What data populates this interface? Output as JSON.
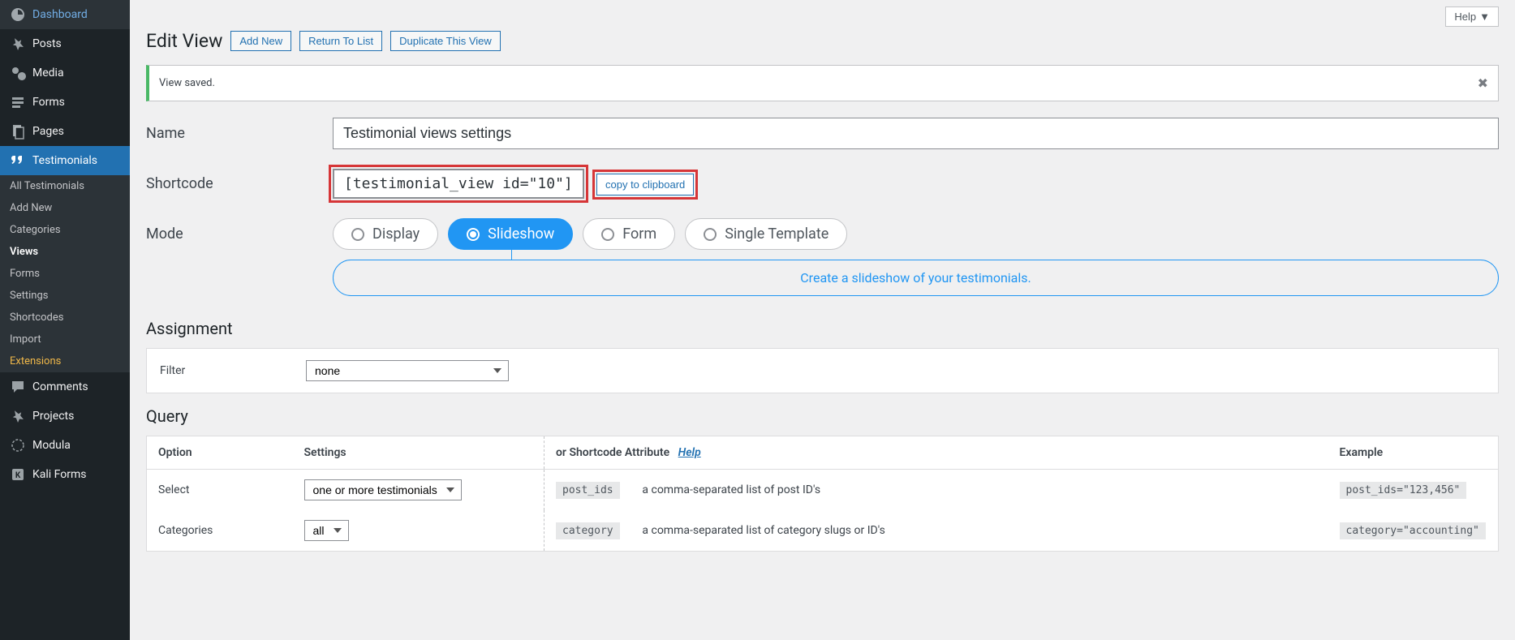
{
  "topbar": {
    "help": "Help"
  },
  "sidebar": {
    "items": [
      {
        "label": "Dashboard",
        "icon": "dashboard"
      },
      {
        "label": "Posts",
        "icon": "pin"
      },
      {
        "label": "Media",
        "icon": "media"
      },
      {
        "label": "Forms",
        "icon": "forms"
      },
      {
        "label": "Pages",
        "icon": "pages"
      },
      {
        "label": "Testimonials",
        "icon": "quote",
        "active": true
      },
      {
        "label": "Comments",
        "icon": "comment"
      },
      {
        "label": "Projects",
        "icon": "pin"
      },
      {
        "label": "Modula",
        "icon": "modula"
      },
      {
        "label": "Kali Forms",
        "icon": "kali"
      }
    ],
    "submenu": [
      {
        "label": "All Testimonials"
      },
      {
        "label": "Add New"
      },
      {
        "label": "Categories"
      },
      {
        "label": "Views",
        "current": true
      },
      {
        "label": "Forms"
      },
      {
        "label": "Settings"
      },
      {
        "label": "Shortcodes"
      },
      {
        "label": "Import"
      },
      {
        "label": "Extensions",
        "highlight": true
      }
    ]
  },
  "header": {
    "title": "Edit View",
    "add_new": "Add New",
    "return": "Return To List",
    "duplicate": "Duplicate This View"
  },
  "notice": {
    "text": "View saved."
  },
  "form": {
    "name_label": "Name",
    "name_value": "Testimonial views settings",
    "shortcode_label": "Shortcode",
    "shortcode_value": "[testimonial_view id=\"10\"]",
    "copy_label": "copy to clipboard",
    "mode_label": "Mode",
    "modes": [
      {
        "label": "Display"
      },
      {
        "label": "Slideshow",
        "active": true
      },
      {
        "label": "Form"
      },
      {
        "label": "Single Template"
      }
    ],
    "mode_description": "Create a slideshow of your testimonials."
  },
  "assignment": {
    "heading": "Assignment",
    "filter_label": "Filter",
    "filter_value": "none"
  },
  "query": {
    "heading": "Query",
    "columns": {
      "option": "Option",
      "settings": "Settings",
      "or_attr": "or Shortcode Attribute",
      "help": "Help",
      "example": "Example"
    },
    "rows": [
      {
        "option": "Select",
        "select_value": "one or more testimonials",
        "attr": "post_ids",
        "desc": "a comma-separated list of post ID's",
        "example": "post_ids=\"123,456\""
      },
      {
        "option": "Categories",
        "select_value": "all",
        "attr": "category",
        "desc": "a comma-separated list of category slugs or ID's",
        "example": "category=\"accounting\""
      }
    ]
  }
}
